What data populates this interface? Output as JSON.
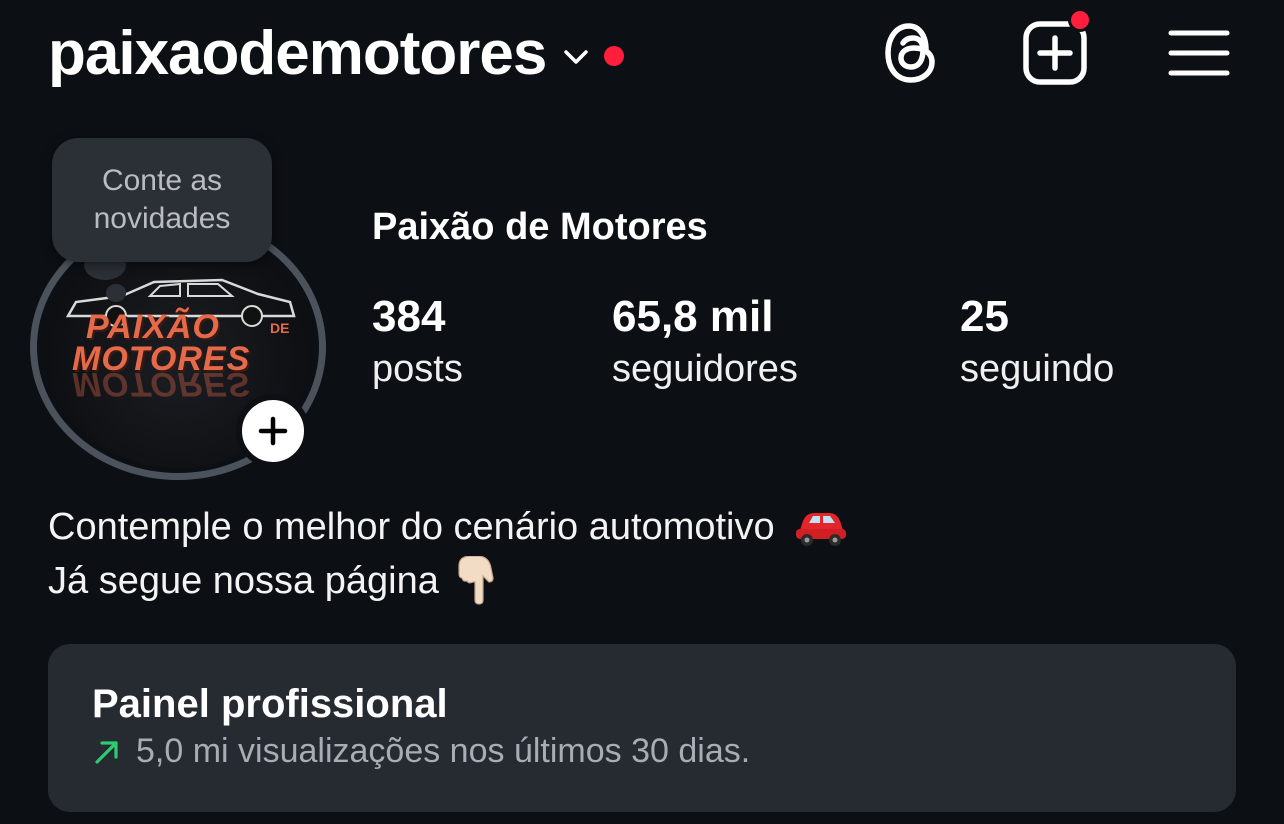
{
  "header": {
    "username": "paixaodemotores",
    "notification_color": "#ff1f3d"
  },
  "profile": {
    "display_name": "Paixão de Motores",
    "note_bubble": {
      "line1": "Conte as",
      "line2": "novidades"
    },
    "logo_text": {
      "line1": "PAIXÃO",
      "de": "DE",
      "line2": "MOTORES"
    },
    "stats": [
      {
        "value": "384",
        "label": "posts"
      },
      {
        "value": "65,8 mil",
        "label": "seguidores"
      },
      {
        "value": "25",
        "label": "seguindo"
      }
    ]
  },
  "bio": {
    "line1": "Contemple o melhor do cenário automotivo",
    "line2": "Já segue nossa página"
  },
  "dashboard": {
    "title": "Painel profissional",
    "subtitle": "5,0 mi visualizações nos últimos 30 dias.",
    "trend_color": "#2ecc71"
  }
}
